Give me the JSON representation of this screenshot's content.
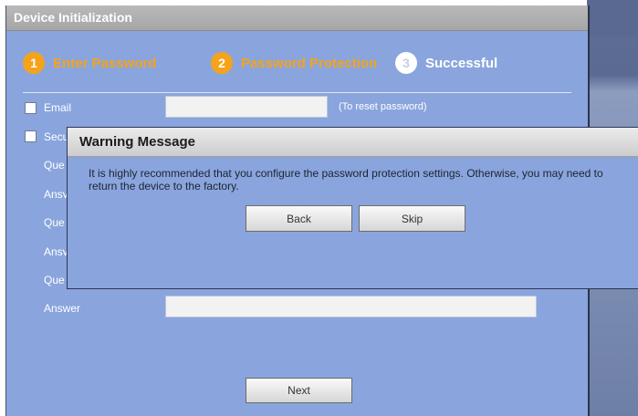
{
  "dialog": {
    "title": "Device Initialization",
    "steps": [
      {
        "num": "1",
        "label": "Enter Password",
        "state": "active"
      },
      {
        "num": "2",
        "label": "Password Protection",
        "state": "active"
      },
      {
        "num": "3",
        "label": "Successful",
        "state": "todo"
      }
    ],
    "form": {
      "email_label": "Email",
      "email_value": "",
      "email_hint": "(To reset password)",
      "security_label": "Secu",
      "q1_label": "Que",
      "a1_label": "Ansv",
      "q2_label": "Que",
      "a2_label": "Ansv",
      "q3_label": "Que",
      "a3_label": "Answer",
      "a3_value": ""
    },
    "next_label": "Next"
  },
  "warning": {
    "title": "Warning Message",
    "message": "It is highly recommended that you configure the password protection settings. Otherwise, you may need to return the device to the factory.",
    "back_label": "Back",
    "skip_label": "Skip"
  },
  "colors": {
    "panel_bg": "#8aa5dd",
    "accent_orange": "#f5a31a",
    "title_gray": "#b0b0b0"
  }
}
